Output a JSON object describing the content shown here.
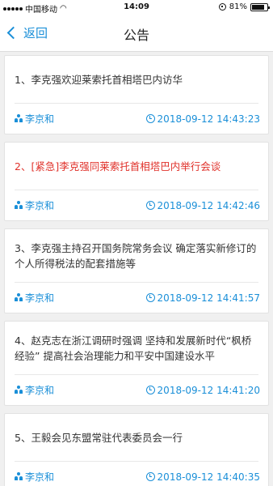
{
  "status_bar": {
    "carrier": "中国移动",
    "time": "14:09",
    "battery": "81%",
    "battery_level": 0.81
  },
  "nav": {
    "back_label": "返回",
    "title": "公告"
  },
  "announcements": [
    {
      "title": "1、李克强欢迎莱索托首相塔巴内访华",
      "author": "李京和",
      "time": "2018-09-12 14:43:23",
      "urgent": false
    },
    {
      "title": "2、[紧急]李克强同莱索托首相塔巴内举行会谈",
      "author": "李京和",
      "time": "2018-09-12 14:42:46",
      "urgent": true
    },
    {
      "title": "3、李克强主持召开国务院常务会议 确定落实新修订的个人所得税法的配套措施等",
      "author": "李京和",
      "time": "2018-09-12 14:41:57",
      "urgent": false
    },
    {
      "title": "4、赵克志在浙江调研时强调 坚持和发展新时代“枫桥经验” 提高社会治理能力和平安中国建设水平",
      "author": "李京和",
      "time": "2018-09-12 14:41:20",
      "urgent": false
    },
    {
      "title": "5、王毅会见东盟常驻代表委员会一行",
      "author": "李京和",
      "time": "2018-09-12 14:40:35",
      "urgent": false
    }
  ]
}
